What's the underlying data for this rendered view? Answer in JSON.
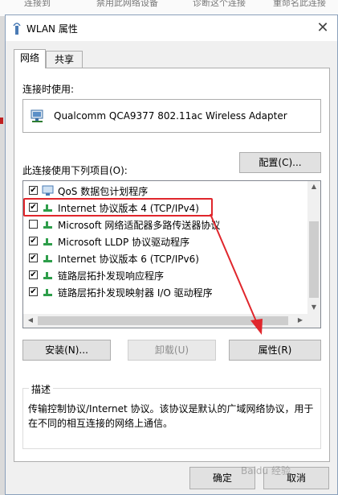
{
  "background_windows": {
    "menu_items": [
      "连接到",
      "禁用此网络设备",
      "诊断这个连接",
      "重命名此连接"
    ]
  },
  "dialog": {
    "title": "WLAN 属性",
    "close_symbol": "✕",
    "tabs": [
      {
        "label": "网络",
        "active": true
      },
      {
        "label": "共享",
        "active": false
      }
    ],
    "connect_using_label": "连接时使用:",
    "adapter_name": "Qualcomm QCA9377 802.11ac Wireless Adapter",
    "configure_button": "配置(C)...",
    "items_label": "此连接使用下列项目(O):",
    "items": [
      {
        "label": "QoS 数据包计划程序",
        "checked": true,
        "icon": "qos-icon"
      },
      {
        "label": "Internet 协议版本 4 (TCP/IPv4)",
        "checked": true,
        "icon": "protocol-icon"
      },
      {
        "label": "Microsoft 网络适配器多路传送器协议",
        "checked": false,
        "icon": "protocol-icon"
      },
      {
        "label": "Microsoft LLDP 协议驱动程序",
        "checked": true,
        "icon": "protocol-icon"
      },
      {
        "label": "Internet 协议版本 6 (TCP/IPv6)",
        "checked": true,
        "icon": "protocol-icon"
      },
      {
        "label": "链路层拓扑发现响应程序",
        "checked": true,
        "icon": "protocol-icon"
      },
      {
        "label": "链路层拓扑发现映射器 I/O 驱动程序",
        "checked": true,
        "icon": "protocol-icon"
      }
    ],
    "install_button": "安装(N)...",
    "uninstall_button": "卸载(U)",
    "properties_button": "属性(R)",
    "description_label": "描述",
    "description_text": "传输控制协议/Internet 协议。该协议是默认的广域网络协议，用于在不同的相互连接的网络上通信。",
    "ok_button": "确定",
    "cancel_button": "取消"
  },
  "watermark": "Baidu 经验",
  "colors": {
    "annotation_red": "#e0262c",
    "panel_border": "#adadad",
    "dialog_border": "#8aa0bb"
  }
}
